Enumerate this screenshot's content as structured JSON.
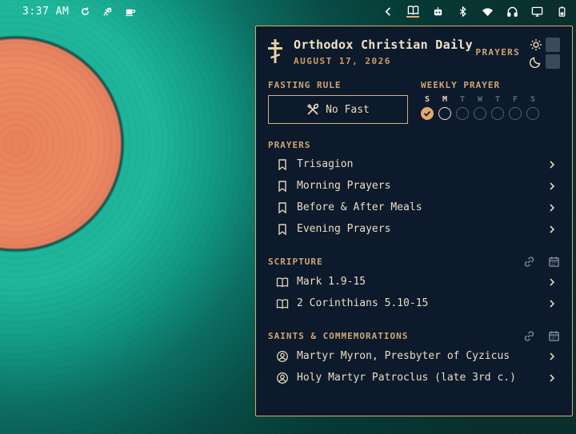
{
  "topbar": {
    "clock": "3:37 AM"
  },
  "panel": {
    "title": "Orthodox Christian Daily",
    "date": "AUGUST 17, 2026",
    "prayers_tag": "PRAYERS",
    "fasting": {
      "label": "FASTING RULE",
      "value": "No Fast"
    },
    "weekly": {
      "label": "WEEKLY PRAYER",
      "days": [
        "S",
        "M",
        "T",
        "W",
        "T",
        "F",
        "S"
      ]
    },
    "prayers": {
      "label": "PRAYERS",
      "items": [
        "Trisagion",
        "Morning Prayers",
        "Before & After Meals",
        "Evening Prayers"
      ]
    },
    "scripture": {
      "label": "SCRIPTURE",
      "items": [
        "Mark 1.9-15",
        "2 Corinthians 5.10-15"
      ]
    },
    "saints": {
      "label": "SAINTS & COMMEMORATIONS",
      "items": [
        "Martyr Myron, Presbyter of Cyzicus",
        "Holy Martyr Patroclus (late 3rd c.)"
      ]
    }
  },
  "colors": {
    "accent": "#e0a867",
    "panel_bg": "#0c1a2c"
  }
}
